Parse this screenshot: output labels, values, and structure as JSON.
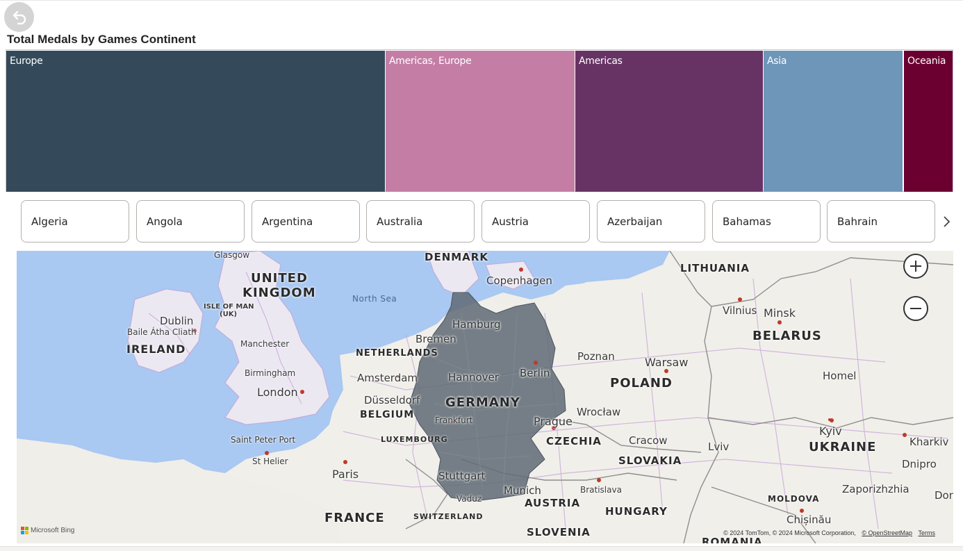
{
  "chart_data": {
    "type": "treemap",
    "title": "Total Medals by Games Continent",
    "categories": [
      "Europe",
      "Americas, Europe",
      "Americas",
      "Asia",
      "Oceania"
    ],
    "colors": [
      "#344a5a",
      "#c47ea6",
      "#673365",
      "#6e96b8",
      "#6b0030"
    ],
    "values": [
      40.0,
      20.0,
      19.9,
      14.8,
      5.3
    ],
    "values_note_unit": "percent of total area"
  },
  "slicer": {
    "items": [
      "Algeria",
      "Angola",
      "Argentina",
      "Australia",
      "Austria",
      "Azerbaijan",
      "Bahamas",
      "Bahrain"
    ]
  },
  "map": {
    "countries": [
      "DENMARK",
      "LITHUANIA",
      "UNITED",
      "KINGDOM",
      "IRELAND",
      "NETHERLANDS",
      "BELARUS",
      "BELGIUM",
      "GERMANY",
      "POLAND",
      "LUXEMBOURG",
      "CZECHIA",
      "UKRAINE",
      "SLOVAKIA",
      "MOLDOVA",
      "AUSTRIA",
      "HUNGARY",
      "FRANCE",
      "SWITZERLAND",
      "SLOVENIA",
      "ROMANIA"
    ],
    "cities": [
      "Glasgow",
      "Copenhagen",
      "Dublin",
      "Baile Átha Cliath",
      "Manchester",
      "Birmingham",
      "London",
      "Hamburg",
      "Bremen",
      "Amsterdam",
      "Hannover",
      "Berlin",
      "Düsseldorf",
      "Frankfurt",
      "Stuttgart",
      "Munich",
      "Vaduz",
      "Paris",
      "Saint Peter Port",
      "St Helier",
      "Poznan",
      "Warsaw",
      "Wrocław",
      "Prague",
      "Cracow",
      "Bratislava",
      "Vilnius",
      "Minsk",
      "Homel",
      "Lviv",
      "Kyiv",
      "Kharkiv",
      "Dnipro",
      "Zaporizhzhia",
      "Chișinău",
      "Don"
    ],
    "islands": [
      "ISLE OF MAN",
      "(UK)"
    ],
    "water": "North Sea",
    "highlighted_country": "GERMANY",
    "highlight_color": "#5f6a74",
    "bing_label": "Microsoft Bing",
    "copyright": "© 2024 TomTom, © 2024 Microsoft Corporation,",
    "osm_link": "© OpenStreetMap",
    "terms_link": "Terms"
  }
}
